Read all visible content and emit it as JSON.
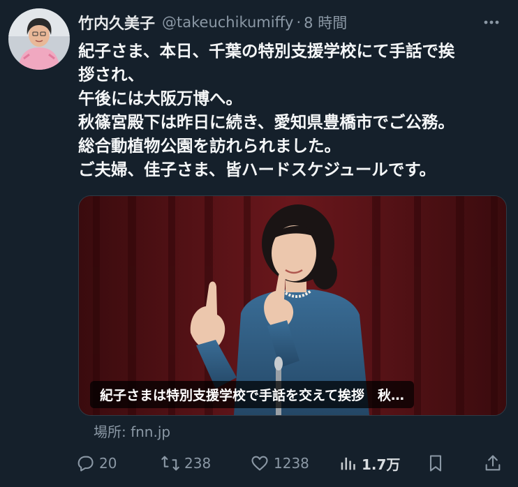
{
  "tweet": {
    "display_name": "竹内久美子",
    "handle": "@takeuchikumiffy",
    "separator": "·",
    "time": "8 時間",
    "text_lines": [
      "紀子さま、本日、千葉の特別支援学校にて手話で挨",
      "拶され、",
      "午後には大阪万博へ。",
      "秋篠宮殿下は昨日に続き、愛知県豊橋市でご公務。",
      "総合動植物公園を訪れられました。",
      "ご夫婦、佳子さま、皆ハードスケジュールです。"
    ],
    "media": {
      "caption": "紀子さまは特別支援学校で手話を交えて挨拶　秋…"
    },
    "source": "場所: fnn.jp"
  },
  "actions": {
    "replies": "20",
    "retweets": "238",
    "likes": "1238",
    "views": "1.7万"
  },
  "icons": {
    "more": "more-icon",
    "reply": "reply-icon",
    "retweet": "retweet-icon",
    "like": "heart-icon",
    "views": "views-icon",
    "bookmark": "bookmark-icon",
    "share": "share-icon"
  },
  "colors": {
    "background": "#15202b",
    "text": "#e7e9ea",
    "secondary": "#8b98a5",
    "curtain": "#5a1418",
    "jacket": "#2f5a7e"
  }
}
